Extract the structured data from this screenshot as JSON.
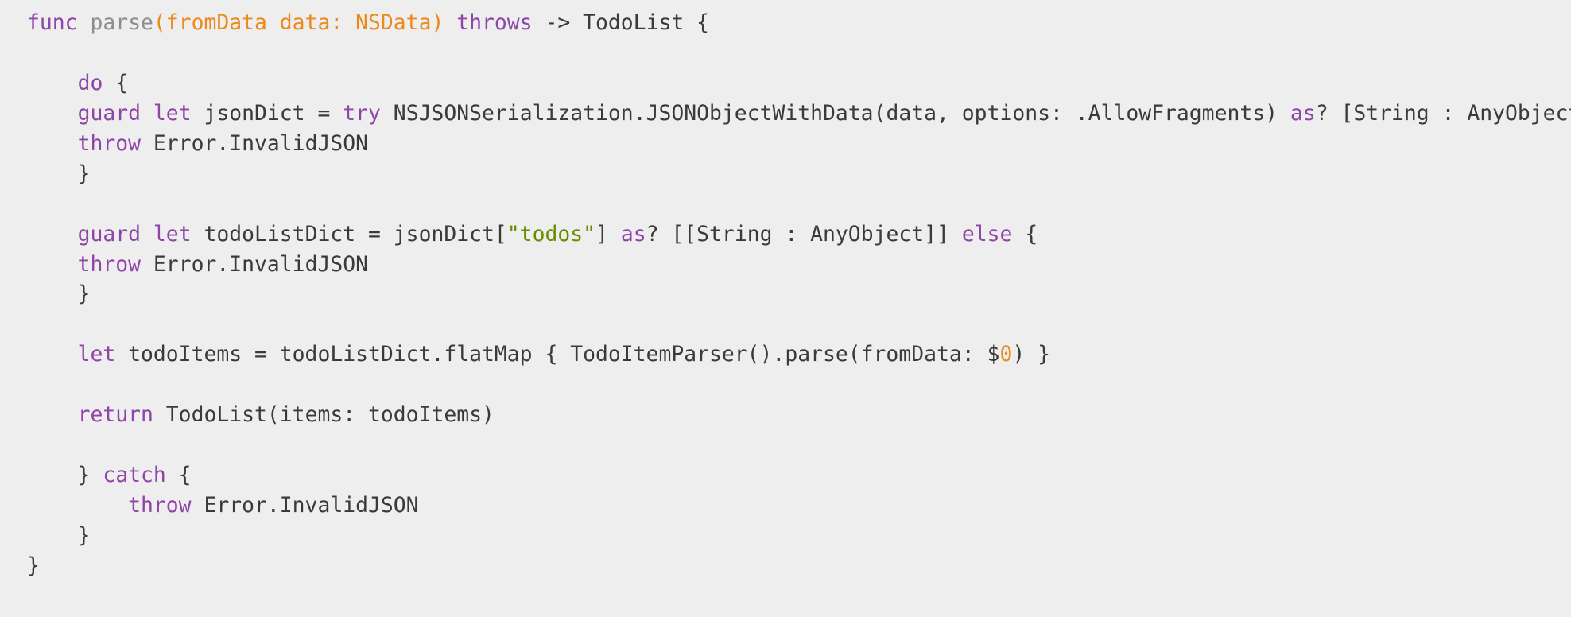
{
  "code_lines": [
    [
      {
        "t": "func",
        "k": "kw"
      },
      {
        "t": " "
      },
      {
        "t": "parse",
        "k": "fn"
      },
      {
        "t": "(fromData data: NSData)",
        "k": "param"
      },
      {
        "t": " "
      },
      {
        "t": "throws",
        "k": "kw"
      },
      {
        "t": " -> TodoList {"
      }
    ],
    [],
    [
      {
        "t": "    "
      },
      {
        "t": "do",
        "k": "kw"
      },
      {
        "t": " {"
      }
    ],
    [
      {
        "t": "    "
      },
      {
        "t": "guard",
        "k": "kw"
      },
      {
        "t": " "
      },
      {
        "t": "let",
        "k": "kw"
      },
      {
        "t": " jsonDict = "
      },
      {
        "t": "try",
        "k": "kw"
      },
      {
        "t": " NSJSONSerialization.JSONObjectWithData(data, options: .AllowFragments) "
      },
      {
        "t": "as",
        "k": "kw"
      },
      {
        "t": "? [String : AnyObject]"
      }
    ],
    [
      {
        "t": "    "
      },
      {
        "t": "throw",
        "k": "kw"
      },
      {
        "t": " Error.InvalidJSON"
      }
    ],
    [
      {
        "t": "    }"
      }
    ],
    [],
    [
      {
        "t": "    "
      },
      {
        "t": "guard",
        "k": "kw"
      },
      {
        "t": " "
      },
      {
        "t": "let",
        "k": "kw"
      },
      {
        "t": " todoListDict = jsonDict["
      },
      {
        "t": "\"todos\"",
        "k": "str"
      },
      {
        "t": "] "
      },
      {
        "t": "as",
        "k": "kw"
      },
      {
        "t": "? [[String : AnyObject]] "
      },
      {
        "t": "else",
        "k": "kw"
      },
      {
        "t": " {"
      }
    ],
    [
      {
        "t": "    "
      },
      {
        "t": "throw",
        "k": "kw"
      },
      {
        "t": " Error.InvalidJSON"
      }
    ],
    [
      {
        "t": "    }"
      }
    ],
    [],
    [
      {
        "t": "    "
      },
      {
        "t": "let",
        "k": "kw"
      },
      {
        "t": " todoItems = todoListDict.flatMap { TodoItemParser().parse(fromData: $"
      },
      {
        "t": "0",
        "k": "num"
      },
      {
        "t": ") }"
      }
    ],
    [],
    [
      {
        "t": "    "
      },
      {
        "t": "return",
        "k": "kw"
      },
      {
        "t": " TodoList(items: todoItems)"
      }
    ],
    [],
    [
      {
        "t": "    } "
      },
      {
        "t": "catch",
        "k": "kw"
      },
      {
        "t": " {"
      }
    ],
    [
      {
        "t": "        "
      },
      {
        "t": "throw",
        "k": "kw"
      },
      {
        "t": " Error.InvalidJSON"
      }
    ],
    [
      {
        "t": "    }"
      }
    ],
    [
      {
        "t": "}"
      }
    ]
  ],
  "token_colors": {
    "kw": "#8e45a7",
    "fn": "#8e8e8e",
    "param": "#ec8a1e",
    "str": "#6a8d00",
    "num": "#ec8a1e",
    "plain": "#3a3a3a"
  }
}
